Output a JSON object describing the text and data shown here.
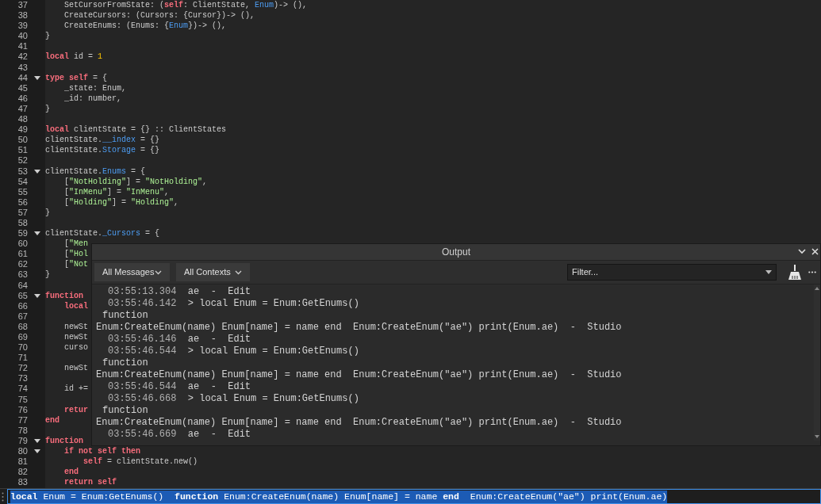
{
  "editor": {
    "lines": [
      {
        "number": "37",
        "fold": false,
        "tokens": [
          {
            "kind": "plain",
            "text": "    SetCursorFromState: ("
          },
          {
            "kind": "keyword",
            "text": "self"
          },
          {
            "kind": "plain",
            "text": ": ClientState, "
          },
          {
            "kind": "type",
            "text": "Enum"
          },
          {
            "kind": "plain",
            "text": ")-> (),"
          }
        ]
      },
      {
        "number": "38",
        "fold": false,
        "tokens": [
          {
            "kind": "plain",
            "text": "    CreateCursors: (Cursors: {Cursor})-> (),"
          }
        ]
      },
      {
        "number": "39",
        "fold": false,
        "tokens": [
          {
            "kind": "plain",
            "text": "    CreateEnums: (Enums: {"
          },
          {
            "kind": "type",
            "text": "Enum"
          },
          {
            "kind": "plain",
            "text": "})-> (),"
          }
        ]
      },
      {
        "number": "40",
        "fold": false,
        "tokens": [
          {
            "kind": "plain",
            "text": "}"
          }
        ]
      },
      {
        "number": "41",
        "fold": false
      },
      {
        "number": "42",
        "fold": false,
        "tokens": [
          {
            "kind": "keyword",
            "text": "local"
          },
          {
            "kind": "plain",
            "text": " id = "
          },
          {
            "kind": "number",
            "text": "1"
          }
        ]
      },
      {
        "number": "43",
        "fold": false
      },
      {
        "number": "44",
        "fold": true,
        "tokens": [
          {
            "kind": "keyword",
            "text": "type self"
          },
          {
            "kind": "plain",
            "text": " = {"
          }
        ]
      },
      {
        "number": "45",
        "fold": false,
        "tokens": [
          {
            "kind": "plain",
            "text": "    _state: Enum,"
          }
        ]
      },
      {
        "number": "46",
        "fold": false,
        "tokens": [
          {
            "kind": "plain",
            "text": "    _id: number,"
          }
        ]
      },
      {
        "number": "47",
        "fold": false,
        "tokens": [
          {
            "kind": "plain",
            "text": "}"
          }
        ]
      },
      {
        "number": "48",
        "fold": false
      },
      {
        "number": "49",
        "fold": false,
        "tokens": [
          {
            "kind": "keyword",
            "text": "local"
          },
          {
            "kind": "plain",
            "text": " clientState = {} :: ClientStates"
          }
        ]
      },
      {
        "number": "50",
        "fold": false,
        "tokens": [
          {
            "kind": "plain",
            "text": "clientState."
          },
          {
            "kind": "type",
            "text": "__index"
          },
          {
            "kind": "plain",
            "text": " = {}"
          }
        ]
      },
      {
        "number": "51",
        "fold": false,
        "tokens": [
          {
            "kind": "plain",
            "text": "clientState."
          },
          {
            "kind": "type",
            "text": "Storage"
          },
          {
            "kind": "plain",
            "text": " = {}"
          }
        ]
      },
      {
        "number": "52",
        "fold": false
      },
      {
        "number": "53",
        "fold": true,
        "tokens": [
          {
            "kind": "plain",
            "text": "clientState."
          },
          {
            "kind": "type",
            "text": "Enums"
          },
          {
            "kind": "plain",
            "text": " = {"
          }
        ]
      },
      {
        "number": "54",
        "fold": false,
        "tokens": [
          {
            "kind": "plain",
            "text": "    ["
          },
          {
            "kind": "string",
            "text": "\"NotHolding\""
          },
          {
            "kind": "plain",
            "text": "] = "
          },
          {
            "kind": "string",
            "text": "\"NotHolding\""
          },
          {
            "kind": "plain",
            "text": ","
          }
        ]
      },
      {
        "number": "55",
        "fold": false,
        "tokens": [
          {
            "kind": "plain",
            "text": "    ["
          },
          {
            "kind": "string",
            "text": "\"InMenu\""
          },
          {
            "kind": "plain",
            "text": "] = "
          },
          {
            "kind": "string",
            "text": "\"InMenu\""
          },
          {
            "kind": "plain",
            "text": ","
          }
        ]
      },
      {
        "number": "56",
        "fold": false,
        "tokens": [
          {
            "kind": "plain",
            "text": "    ["
          },
          {
            "kind": "string",
            "text": "\"Holding\""
          },
          {
            "kind": "plain",
            "text": "] = "
          },
          {
            "kind": "string",
            "text": "\"Holding\""
          },
          {
            "kind": "plain",
            "text": ","
          }
        ]
      },
      {
        "number": "57",
        "fold": false,
        "tokens": [
          {
            "kind": "plain",
            "text": "}"
          }
        ]
      },
      {
        "number": "58",
        "fold": false
      },
      {
        "number": "59",
        "fold": true,
        "tokens": [
          {
            "kind": "plain",
            "text": "clientState."
          },
          {
            "kind": "type",
            "text": "_Cursors"
          },
          {
            "kind": "plain",
            "text": " = {"
          }
        ]
      },
      {
        "number": "60",
        "fold": false,
        "tokens": [
          {
            "kind": "plain",
            "text": "    ["
          },
          {
            "kind": "string",
            "text": "\"Men"
          }
        ]
      },
      {
        "number": "61",
        "fold": false,
        "tokens": [
          {
            "kind": "plain",
            "text": "    ["
          },
          {
            "kind": "string",
            "text": "\"Hol"
          }
        ]
      },
      {
        "number": "62",
        "fold": false,
        "tokens": [
          {
            "kind": "plain",
            "text": "    ["
          },
          {
            "kind": "string",
            "text": "\"Not"
          }
        ]
      },
      {
        "number": "63",
        "fold": false,
        "tokens": [
          {
            "kind": "plain",
            "text": "}"
          }
        ]
      },
      {
        "number": "64",
        "fold": false
      },
      {
        "number": "65",
        "fold": true,
        "tokens": [
          {
            "kind": "keyword",
            "text": "function"
          }
        ]
      },
      {
        "number": "66",
        "fold": false,
        "tokens": [
          {
            "kind": "keyword",
            "text": "    local"
          }
        ]
      },
      {
        "number": "67",
        "fold": false
      },
      {
        "number": "68",
        "fold": false,
        "tokens": [
          {
            "kind": "plain",
            "text": "    newSt"
          }
        ]
      },
      {
        "number": "69",
        "fold": false,
        "tokens": [
          {
            "kind": "plain",
            "text": "    newSt"
          }
        ]
      },
      {
        "number": "70",
        "fold": false,
        "tokens": [
          {
            "kind": "plain",
            "text": "    curso"
          }
        ]
      },
      {
        "number": "71",
        "fold": false
      },
      {
        "number": "72",
        "fold": false,
        "tokens": [
          {
            "kind": "plain",
            "text": "    newSt"
          }
        ]
      },
      {
        "number": "73",
        "fold": false
      },
      {
        "number": "74",
        "fold": false,
        "tokens": [
          {
            "kind": "plain",
            "text": "    id +="
          }
        ]
      },
      {
        "number": "75",
        "fold": false
      },
      {
        "number": "76",
        "fold": false,
        "tokens": [
          {
            "kind": "keyword",
            "text": "    retur"
          }
        ]
      },
      {
        "number": "77",
        "fold": false,
        "tokens": [
          {
            "kind": "keyword",
            "text": "end"
          }
        ]
      },
      {
        "number": "78",
        "fold": false
      },
      {
        "number": "79",
        "fold": true,
        "tokens": [
          {
            "kind": "keyword",
            "text": "function"
          }
        ]
      },
      {
        "number": "80",
        "fold": true,
        "tokens": [
          {
            "kind": "keyword",
            "text": "    if not self then"
          }
        ]
      },
      {
        "number": "81",
        "fold": false,
        "tokens": [
          {
            "kind": "keyword",
            "text": "        self"
          },
          {
            "kind": "plain",
            "text": " = clientState.new()"
          }
        ]
      },
      {
        "number": "82",
        "fold": false,
        "tokens": [
          {
            "kind": "keyword",
            "text": "    end"
          }
        ]
      },
      {
        "number": "83",
        "fold": false,
        "tokens": [
          {
            "kind": "keyword",
            "text": "    return self"
          }
        ]
      }
    ]
  },
  "output": {
    "title": "Output",
    "filters": [
      "All Messages",
      "All Contexts"
    ],
    "filter_field": {
      "placeholder": "Filter..."
    },
    "log": [
      {
        "kind": "entry",
        "time": "03:55:13.304",
        "text": "ae  -  Edit"
      },
      {
        "kind": "entry",
        "time": "03:55:46.142",
        "text": "> local Enum = Enum:GetEnums()"
      },
      {
        "kind": "message",
        "text": "function"
      },
      {
        "kind": "wrap",
        "text": "Enum:CreateEnum(name) Enum[name] = name end  Enum:CreateEnum(\"ae\") print(Enum.ae)  -  Studio"
      },
      {
        "kind": "entry",
        "time": "03:55:46.146",
        "text": "ae  -  Edit"
      },
      {
        "kind": "entry",
        "time": "03:55:46.544",
        "text": "> local Enum = Enum:GetEnums()"
      },
      {
        "kind": "message",
        "text": "function"
      },
      {
        "kind": "wrap",
        "text": "Enum:CreateEnum(name) Enum[name] = name end  Enum:CreateEnum(\"ae\") print(Enum.ae)  -  Studio"
      },
      {
        "kind": "entry",
        "time": "03:55:46.544",
        "text": "ae  -  Edit"
      },
      {
        "kind": "entry",
        "time": "03:55:46.668",
        "text": "> local Enum = Enum:GetEnums()"
      },
      {
        "kind": "message",
        "text": "function"
      },
      {
        "kind": "wrap",
        "text": "Enum:CreateEnum(name) Enum[name] = name end  Enum:CreateEnum(\"ae\") print(Enum.ae)  -  Studio"
      },
      {
        "kind": "entry",
        "time": "03:55:46.669",
        "text": "ae  -  Edit"
      }
    ]
  },
  "command_bar": {
    "value": "**local** Enum = Enum:GetEnums()  **function** Enum:CreateEnum(name) Enum[name] = name **end**  Enum:CreateEnum(\"ae\") print(Enum.ae)",
    "selected": true
  }
}
